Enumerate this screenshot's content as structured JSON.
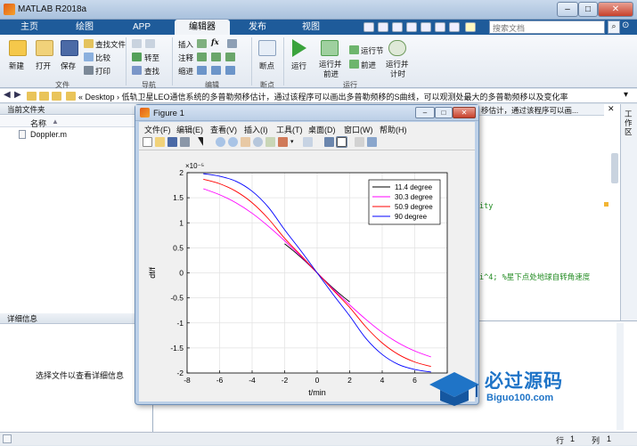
{
  "app": {
    "title": "MATLAB R2018a",
    "tabs": [
      {
        "label": "主页"
      },
      {
        "label": "绘图"
      },
      {
        "label": "APP"
      },
      {
        "label": "编辑器"
      },
      {
        "label": "发布"
      },
      {
        "label": "视图"
      }
    ],
    "search_placeholder": "搜索文档"
  },
  "toolstrip": {
    "file": {
      "new": "新建",
      "open": "打开",
      "save": "保存",
      "find_files": "查找文件",
      "compare": "比较",
      "print": "打印",
      "group": "文件"
    },
    "nav": {
      "goto": "转至",
      "find": "查找",
      "group": "导航"
    },
    "edit": {
      "insert": "插入",
      "comment": "注释",
      "indent": "缩进",
      "fx": "fx",
      "group": "编辑"
    },
    "breakpoint": {
      "label": "断点",
      "group": "断点"
    },
    "run": {
      "run": "运行",
      "run_advance_1": "运行并",
      "run_advance_2": "前进",
      "run_section": "运行节",
      "advance": "前进",
      "run_time_1": "运行并",
      "run_time_2": "计时",
      "group": "运行"
    }
  },
  "address": {
    "crumbs": "«  Desktop  ›  低轨卫星LEO通信系统的多普勒频移估计，通过该程序可以画出多普勒频移的S曲线，可以观测处最大的多普勒频移以及变化率"
  },
  "left_pane": {
    "header": "当前文件夹",
    "col_name": "名称",
    "files": [
      {
        "name": "Doppler.m"
      }
    ],
    "details_header": "详细信息",
    "details_hint": "选择文件以查看详细信息"
  },
  "editor": {
    "crumb": "移估计，通过该程序可以画...",
    "side_label": "工作区",
    "fragment_1": "ity",
    "fragment_2": "i^4;  %星下点处地球自转角速度"
  },
  "statusbar": {
    "row_label": "行",
    "row": "1",
    "col_label": "列",
    "col": "1"
  },
  "figure": {
    "title": "Figure 1",
    "menus": [
      "文件(F)",
      "编辑(E)",
      "查看(V)",
      "插入(I)",
      "工具(T)",
      "桌面(D)",
      "窗口(W)",
      "帮助(H)"
    ]
  },
  "chart_data": {
    "type": "line",
    "xlabel": "t/min",
    "ylabel": "df/f",
    "yexponent": "×10⁻⁵",
    "xlim": [
      -8,
      8
    ],
    "ylim": [
      -2,
      2
    ],
    "xticks": [
      -8,
      -6,
      -4,
      -2,
      0,
      2,
      4,
      6,
      8
    ],
    "yticks": [
      -2,
      -1.5,
      -1,
      -0.5,
      0,
      0.5,
      1,
      1.5,
      2
    ],
    "xtick_labels": [
      "-8",
      "-6",
      "-4",
      "-2",
      "0",
      "2",
      "4",
      "6",
      "8"
    ],
    "ytick_labels": [
      "-2",
      "-1.5",
      "-1",
      "-0.5",
      "0",
      "0.5",
      "1",
      "1.5",
      "2"
    ],
    "grid": true,
    "legend_position": "top-right",
    "series": [
      {
        "name": "11.4 degree",
        "color": "#000000",
        "x": [
          -2.0,
          -1.5,
          -1.0,
          -0.5,
          0.0,
          0.5,
          1.0,
          1.5,
          2.0
        ],
        "y": [
          0.58,
          0.45,
          0.31,
          0.16,
          0.0,
          -0.16,
          -0.31,
          -0.45,
          -0.58
        ]
      },
      {
        "name": "30.3 degree",
        "color": "#ff00ff",
        "x": [
          -7.0,
          -6.0,
          -5.0,
          -4.0,
          -3.0,
          -2.0,
          -1.0,
          0.0,
          1.0,
          2.0,
          3.0,
          4.0,
          5.0,
          6.0,
          7.0
        ],
        "y": [
          1.68,
          1.56,
          1.4,
          1.19,
          0.93,
          0.64,
          0.33,
          0.0,
          -0.33,
          -0.64,
          -0.93,
          -1.19,
          -1.4,
          -1.56,
          -1.68
        ]
      },
      {
        "name": "50.9 degree",
        "color": "#ff0000",
        "x": [
          -7.0,
          -6.0,
          -5.0,
          -4.0,
          -3.0,
          -2.0,
          -1.0,
          0.0,
          1.0,
          2.0,
          3.0,
          4.0,
          5.0,
          6.0,
          7.0
        ],
        "y": [
          1.87,
          1.78,
          1.63,
          1.4,
          1.08,
          0.69,
          0.35,
          0.0,
          -0.35,
          -0.69,
          -1.08,
          -1.4,
          -1.63,
          -1.78,
          -1.87
        ]
      },
      {
        "name": "90 degree",
        "color": "#0000ff",
        "x": [
          -7.0,
          -6.0,
          -5.0,
          -4.0,
          -3.0,
          -2.0,
          -1.0,
          0.0,
          1.0,
          2.0,
          3.0,
          4.0,
          5.0,
          6.0,
          7.0
        ],
        "y": [
          1.98,
          1.93,
          1.83,
          1.63,
          1.31,
          0.86,
          0.44,
          0.0,
          -0.44,
          -0.86,
          -1.31,
          -1.63,
          -1.83,
          -1.93,
          -1.98
        ]
      }
    ]
  },
  "watermark": {
    "brand": "必过源码",
    "url": "Biguo100.com"
  }
}
